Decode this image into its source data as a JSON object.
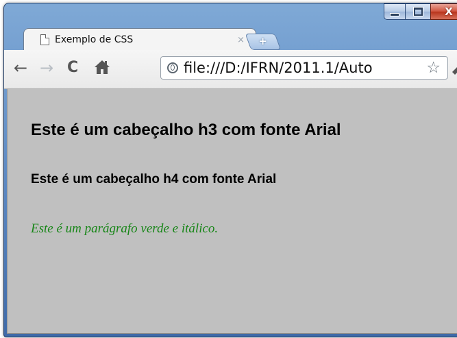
{
  "window": {
    "controls": [
      "minimize",
      "maximize",
      "close"
    ]
  },
  "tab": {
    "title": "Exemplo de CSS",
    "close_glyph": "×",
    "icon": "page-icon"
  },
  "new_tab": {
    "glyph": "+"
  },
  "toolbar": {
    "back_icon": "←",
    "forward_icon": "→",
    "reload_icon": "C",
    "home_icon": "home-icon",
    "url": "file:///D:/IFRN/2011.1/Auto",
    "bookmark_icon": "☆",
    "wrench_icon": "wrench-icon"
  },
  "page": {
    "background": "#c0c0c0",
    "h3": "Este é um cabeçalho h3 com fonte Arial",
    "h4": "Este é um cabeçalho h4 com fonte Arial",
    "paragraph": "Este é um parágrafo verde e itálico.",
    "paragraph_color": "#178617"
  }
}
